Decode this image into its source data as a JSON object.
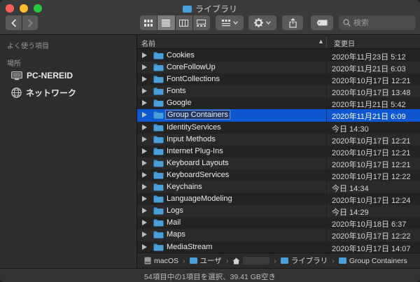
{
  "window": {
    "title": "ライブラリ"
  },
  "toolbar": {
    "back_icon": "chevron-left-icon",
    "forward_icon": "chevron-right-icon",
    "views": [
      "icon-view",
      "list-view",
      "column-view",
      "gallery-view"
    ],
    "active_view": "list-view",
    "search_placeholder": "検索"
  },
  "sidebar": {
    "favorites_heading": "よく使う項目",
    "locations_heading": "場所",
    "locations": [
      {
        "label": "PC-NEREID",
        "icon": "computer-icon"
      },
      {
        "label": "ネットワーク",
        "icon": "network-globe-icon"
      }
    ]
  },
  "list": {
    "col_name": "名前",
    "col_date": "変更日",
    "rows": [
      {
        "name": "Cookies",
        "date": "2020年11月23日 5:12"
      },
      {
        "name": "CoreFollowUp",
        "date": "2020年11月21日 6:03"
      },
      {
        "name": "FontCollections",
        "date": "2020年10月17日 12:21"
      },
      {
        "name": "Fonts",
        "date": "2020年10月17日 13:48"
      },
      {
        "name": "Google",
        "date": "2020年11月21日 5:42"
      },
      {
        "name": "Group Containers",
        "date": "2020年11月21日 6:09",
        "selected": true
      },
      {
        "name": "IdentityServices",
        "date": "今日 14:30"
      },
      {
        "name": "Input Methods",
        "date": "2020年10月17日 12:21"
      },
      {
        "name": "Internet Plug-Ins",
        "date": "2020年10月17日 12:21"
      },
      {
        "name": "Keyboard Layouts",
        "date": "2020年10月17日 12:21"
      },
      {
        "name": "KeyboardServices",
        "date": "2020年10月17日 12:22"
      },
      {
        "name": "Keychains",
        "date": "今日 14:34"
      },
      {
        "name": "LanguageModeling",
        "date": "2020年10月17日 12:24"
      },
      {
        "name": "Logs",
        "date": "今日 14:29"
      },
      {
        "name": "Mail",
        "date": "2020年10月18日 6:37"
      },
      {
        "name": "Maps",
        "date": "2020年10月17日 12:22"
      },
      {
        "name": "MediaStream",
        "date": "2020年10月17日 14:07"
      }
    ]
  },
  "pathbar": {
    "segments": [
      "macOS",
      "ユーザ",
      "ライブラリ",
      "Group Containers"
    ]
  },
  "status": {
    "text": "54項目中の1項目を選択、39.41 GB空き"
  },
  "colors": {
    "folder": "#4a9fd8",
    "selection": "#0f57d0"
  }
}
